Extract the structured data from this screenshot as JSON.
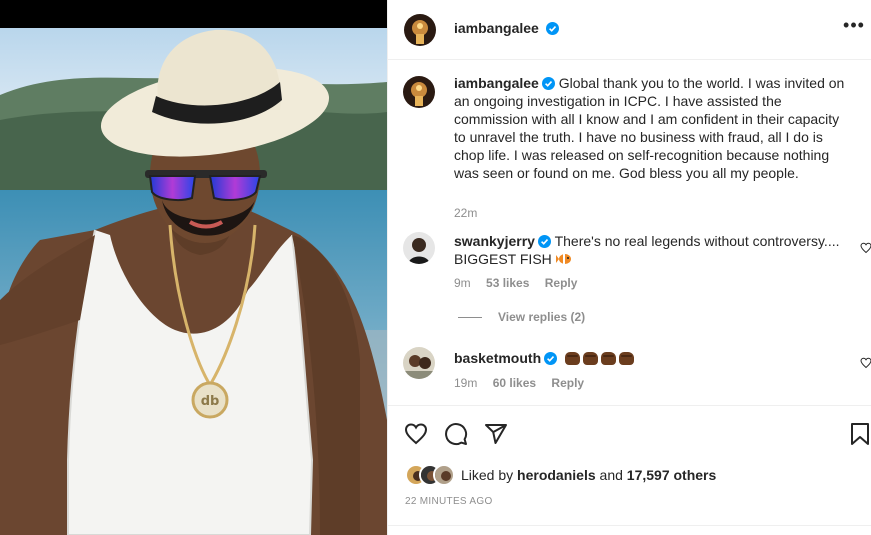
{
  "post": {
    "author": "iambangalee",
    "more_label": "•••"
  },
  "caption": {
    "username": "iambangalee",
    "text": "Global thank you to the world. I was invited on an ongoing investigation in ICPC. I have assisted the commission with all I know and I am confident in their capacity to unravel the truth. I have no business with fraud, all I do is chop life. I was released on self-recognition because nothing was seen or found on me. God bless you all my people.",
    "time": "22m"
  },
  "comments": [
    {
      "username": "swankyjerry",
      "text": "There's no real legends without controversy.... BIGGEST FISH",
      "emoji": "tropical-fish",
      "time": "9m",
      "likes": "53 likes",
      "reply_label": "Reply",
      "view_replies": "View replies (2)"
    },
    {
      "username": "basketmouth",
      "emoji": "fist-bump x4",
      "time": "19m",
      "likes": "60 likes",
      "reply_label": "Reply"
    }
  ],
  "likes": {
    "prefix": "Liked by",
    "user": "herodaniels",
    "and": "and",
    "others": "17,597 others"
  },
  "timestamp": "22 MINUTES AGO",
  "icons": {
    "like": "heart-icon",
    "comment": "comment-icon",
    "share": "share-icon",
    "save": "bookmark-icon",
    "verified": "verified-badge-icon"
  },
  "colors": {
    "verified": "#0095f6",
    "meta_text": "#8e8e8e",
    "divider": "#efefef"
  }
}
